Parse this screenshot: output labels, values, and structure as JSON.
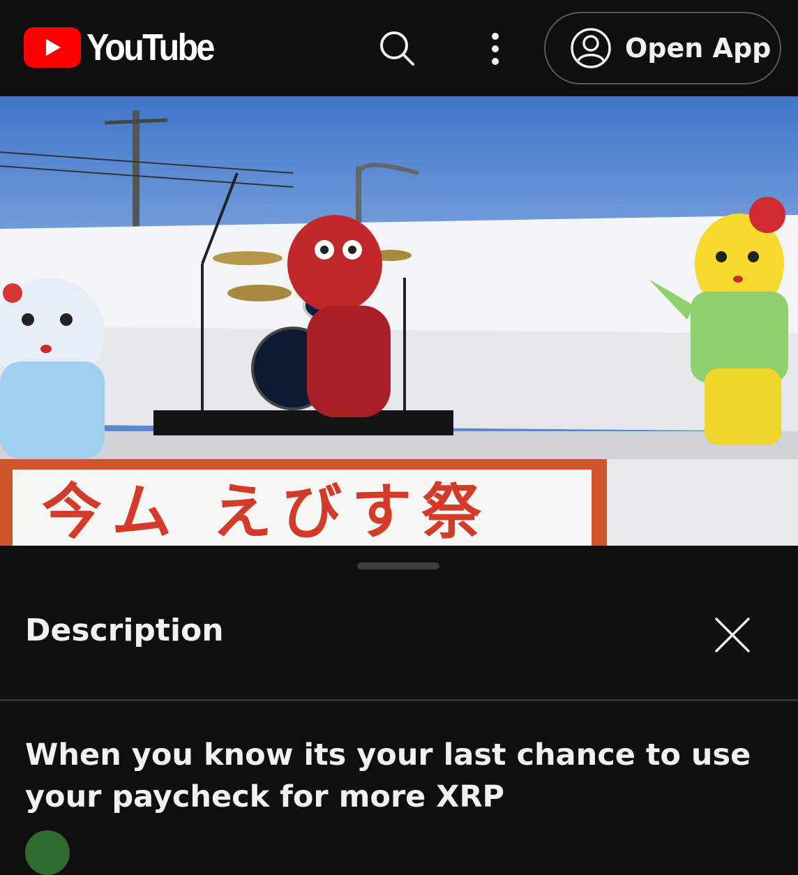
{
  "header": {
    "brand": "YouTube",
    "search_icon": "search-icon",
    "menu_icon": "more-vert-icon",
    "open_app_label": "Open App",
    "open_app_icon": "account-circle-icon"
  },
  "video": {
    "banner_text": "今ム えびす祭"
  },
  "description_panel": {
    "title": "Description",
    "close_icon": "close-icon",
    "video_title": "When you know its your last chance to use your paycheck for more XRP"
  },
  "colors": {
    "brand_red": "#ff0000",
    "background": "#0f0f0f",
    "text": "#f1f1f1"
  }
}
